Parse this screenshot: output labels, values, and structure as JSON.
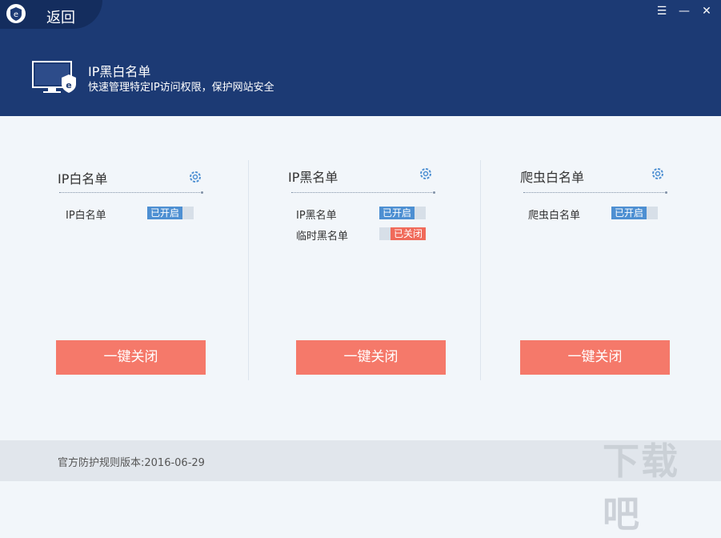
{
  "window": {
    "back_label": "返回",
    "controls": {
      "menu": "☰",
      "minimize": "—",
      "close": "✕"
    }
  },
  "hero": {
    "title": "IP黑白名单",
    "subtitle": "快速管理特定IP访问权限，保护网站安全",
    "logo_letter": "e"
  },
  "colors": {
    "header_bg": "#1c3a74",
    "accent_blue": "#4d8fd2",
    "accent_red": "#f5796a",
    "page_bg": "#f2f6fa"
  },
  "cards": [
    {
      "title": "IP白名单",
      "rows": [
        {
          "label": "IP白名单",
          "status": "已开启",
          "state": "on"
        }
      ],
      "button": "一键关闭"
    },
    {
      "title": "IP黑名单",
      "rows": [
        {
          "label": "IP黑名单",
          "status": "已开启",
          "state": "on"
        },
        {
          "label": "临时黑名单",
          "status": "已关闭",
          "state": "off"
        }
      ],
      "button": "一键关闭"
    },
    {
      "title": "爬虫白名单",
      "rows": [
        {
          "label": "爬虫白名单",
          "status": "已开启",
          "state": "on"
        }
      ],
      "button": "一键关闭"
    }
  ],
  "footer": {
    "text": "官方防护规则版本:2016-06-29"
  },
  "watermark": {
    "text": "下载吧"
  }
}
